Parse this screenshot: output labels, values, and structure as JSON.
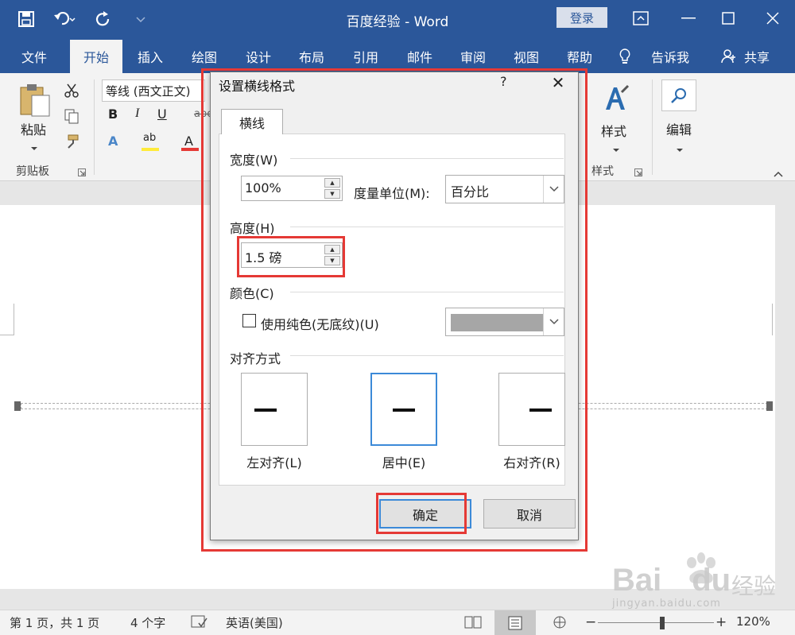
{
  "titlebar": {
    "title": "百度经验  -  Word",
    "login": "登录",
    "colors": {
      "brand": "#2b579a"
    }
  },
  "tabs": [
    {
      "label": "文件"
    },
    {
      "label": "开始"
    },
    {
      "label": "插入"
    },
    {
      "label": "绘图"
    },
    {
      "label": "设计"
    },
    {
      "label": "布局"
    },
    {
      "label": "引用"
    },
    {
      "label": "邮件"
    },
    {
      "label": "审阅"
    },
    {
      "label": "视图"
    },
    {
      "label": "帮助"
    }
  ],
  "tell_me": "告诉我",
  "share": "共享",
  "ribbon": {
    "paste": "粘贴",
    "clipboard": "剪贴板",
    "font_name": "等线 (西文正文)",
    "styles": "样式",
    "styles_group": "样式",
    "edit": "编辑",
    "bold": "B",
    "italic": "I",
    "underline": "U",
    "strike": "abc",
    "font_color": "A",
    "highlight": "ab",
    "text_effect": "A"
  },
  "dialog": {
    "title": "设置横线格式",
    "help": "?",
    "close": "✕",
    "tab": "横线",
    "width_label": "宽度(W)",
    "width_value": "100%",
    "unit_label": "度量单位(M):",
    "unit_value": "百分比",
    "height_label": "高度(H)",
    "height_value": "1.5 磅",
    "color_label": "颜色(C)",
    "solid_color_label": "使用纯色(无底纹)(U)",
    "swatch_color": "#a6a6a6",
    "align_label": "对齐方式",
    "align_left": "左对齐(L)",
    "align_center": "居中(E)",
    "align_right": "右对齐(R)",
    "ok": "确定",
    "cancel": "取消"
  },
  "statusbar": {
    "page": "第 1 页，共 1 页",
    "words": "4 个字",
    "language": "英语(美国)",
    "zoom_minus": "−",
    "zoom_plus": "+",
    "zoom": "120%"
  },
  "watermark": {
    "brand": "Bai",
    "brand2": "du",
    "cn": "经验",
    "url": "jingyan.baidu.com"
  }
}
